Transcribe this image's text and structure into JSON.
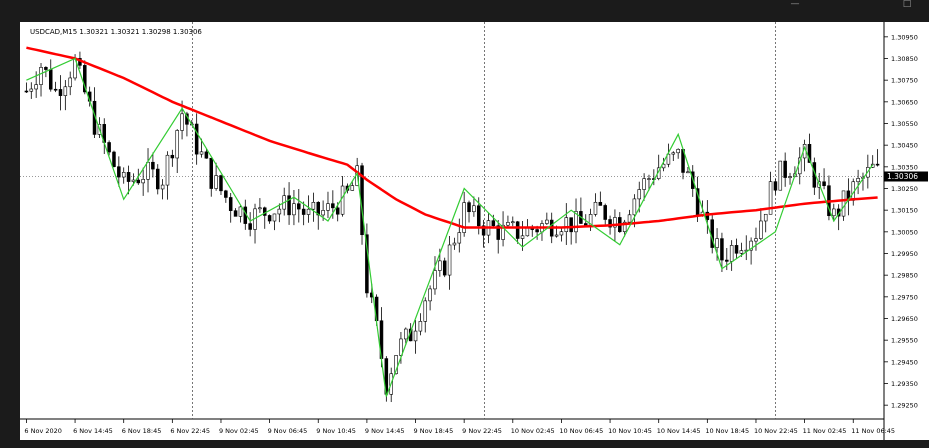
{
  "window": {
    "minimize_icon": "minimize-icon",
    "maximize_icon": "maximize-icon",
    "minimize_glyph": "—",
    "maximize_glyph": "□"
  },
  "chart_data": {
    "type": "candlestick",
    "title": "USDCAD,M15  1.30321 1.30321 1.30298 1.30306",
    "current_price_label": "1.30306",
    "current_price": 1.30306,
    "ylim": [
      1.292,
      1.31
    ],
    "y_ticks": [
      "1.30950",
      "1.30850",
      "1.30750",
      "1.30650",
      "1.30550",
      "1.30450",
      "1.30350",
      "1.30250",
      "1.30150",
      "1.30050",
      "1.29950",
      "1.29850",
      "1.29750",
      "1.29650",
      "1.29550",
      "1.29450",
      "1.29350",
      "1.29250"
    ],
    "y_tick_values": [
      1.3095,
      1.3085,
      1.3075,
      1.3065,
      1.3055,
      1.3045,
      1.3035,
      1.3025,
      1.3015,
      1.3005,
      1.2995,
      1.2985,
      1.2975,
      1.2965,
      1.2955,
      1.2945,
      1.2935,
      1.2925
    ],
    "x_ticks": [
      "6 Nov 2020",
      "6 Nov 14:45",
      "6 Nov 18:45",
      "6 Nov 22:45",
      "9 Nov 02:45",
      "9 Nov 06:45",
      "9 Nov 10:45",
      "9 Nov 14:45",
      "9 Nov 18:45",
      "9 Nov 22:45",
      "10 Nov 02:45",
      "10 Nov 06:45",
      "10 Nov 10:45",
      "10 Nov 14:45",
      "10 Nov 18:45",
      "10 Nov 22:45",
      "11 Nov 02:45",
      "11 Nov 06:45"
    ],
    "x_tick_index": [
      0,
      10,
      20,
      30,
      40,
      50,
      60,
      70,
      80,
      90,
      100,
      110,
      120,
      130,
      140,
      150,
      160,
      170
    ],
    "bar_count": 176,
    "day_separators": [
      34,
      94,
      154
    ],
    "zigzag": [
      [
        0,
        1.3075
      ],
      [
        10,
        1.3085
      ],
      [
        20,
        1.302
      ],
      [
        32,
        1.3062
      ],
      [
        46,
        1.301
      ],
      [
        55,
        1.3021
      ],
      [
        62,
        1.301
      ],
      [
        68,
        1.3032
      ],
      [
        74,
        1.2929
      ],
      [
        90,
        1.3025
      ],
      [
        102,
        1.2998
      ],
      [
        112,
        1.3015
      ],
      [
        122,
        1.2999
      ],
      [
        134,
        1.305
      ],
      [
        143,
        1.2988
      ],
      [
        154,
        1.3005
      ],
      [
        160,
        1.3044
      ],
      [
        166,
        1.301
      ],
      [
        174,
        1.3036
      ]
    ],
    "moving_average": [
      [
        0,
        1.309
      ],
      [
        10,
        1.3085
      ],
      [
        20,
        1.3076
      ],
      [
        30,
        1.3065
      ],
      [
        40,
        1.3056
      ],
      [
        50,
        1.3047
      ],
      [
        60,
        1.304
      ],
      [
        66,
        1.3036
      ],
      [
        70,
        1.3029
      ],
      [
        76,
        1.302
      ],
      [
        82,
        1.3013
      ],
      [
        90,
        1.3007
      ],
      [
        100,
        1.3007
      ],
      [
        110,
        1.3007
      ],
      [
        120,
        1.3008
      ],
      [
        130,
        1.301
      ],
      [
        140,
        1.3013
      ],
      [
        150,
        1.3015
      ],
      [
        160,
        1.3018
      ],
      [
        170,
        1.302
      ],
      [
        176,
        1.3021
      ]
    ],
    "close_anchors": [
      [
        0,
        1.307
      ],
      [
        3,
        1.3082
      ],
      [
        6,
        1.307
      ],
      [
        10,
        1.3083
      ],
      [
        14,
        1.3055
      ],
      [
        17,
        1.304
      ],
      [
        20,
        1.3027
      ],
      [
        24,
        1.3032
      ],
      [
        28,
        1.303
      ],
      [
        32,
        1.306
      ],
      [
        35,
        1.3045
      ],
      [
        38,
        1.303
      ],
      [
        42,
        1.3018
      ],
      [
        46,
        1.3012
      ],
      [
        50,
        1.3015
      ],
      [
        55,
        1.3018
      ],
      [
        58,
        1.3012
      ],
      [
        62,
        1.3015
      ],
      [
        66,
        1.3022
      ],
      [
        68,
        1.303
      ],
      [
        70,
        1.298
      ],
      [
        72,
        1.296
      ],
      [
        74,
        1.2935
      ],
      [
        76,
        1.295
      ],
      [
        79,
        1.2958
      ],
      [
        82,
        1.2975
      ],
      [
        86,
        1.299
      ],
      [
        90,
        1.3015
      ],
      [
        94,
        1.3008
      ],
      [
        98,
        1.3005
      ],
      [
        102,
        1.3005
      ],
      [
        106,
        1.3008
      ],
      [
        110,
        1.301
      ],
      [
        114,
        1.3008
      ],
      [
        118,
        1.3015
      ],
      [
        122,
        1.301
      ],
      [
        126,
        1.3025
      ],
      [
        130,
        1.3035
      ],
      [
        134,
        1.304
      ],
      [
        137,
        1.3025
      ],
      [
        140,
        1.3005
      ],
      [
        143,
        1.2993
      ],
      [
        146,
        1.3
      ],
      [
        150,
        1.3005
      ],
      [
        154,
        1.303
      ],
      [
        157,
        1.3035
      ],
      [
        160,
        1.304
      ],
      [
        163,
        1.3025
      ],
      [
        166,
        1.3012
      ],
      [
        170,
        1.3025
      ],
      [
        174,
        1.3034
      ],
      [
        176,
        1.3031
      ]
    ],
    "colors": {
      "background": "#ffffff",
      "candle": "#000000",
      "zigzag": "#33cc33",
      "moving_average": "#ff0000",
      "grid_dashed": "#555555",
      "frame": "#1b1b1b",
      "price_label_bg": "#000000",
      "price_label_text": "#ffffff"
    },
    "grid": false,
    "legend": "none"
  }
}
